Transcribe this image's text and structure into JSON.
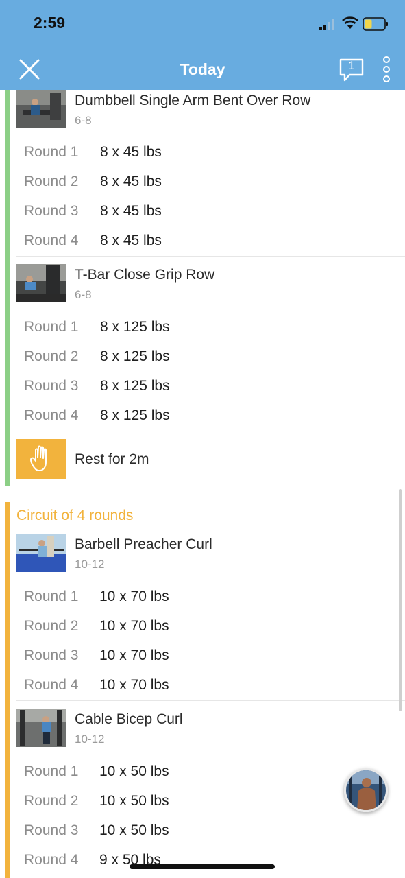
{
  "status_bar": {
    "time": "2:59"
  },
  "header": {
    "title": "Today",
    "chat_count": "1"
  },
  "colors": {
    "header": "#68ace0",
    "green_bar": "#8ccf86",
    "orange_bar": "#f2b33d",
    "circuit_title": "#f2b33d"
  },
  "set1": {
    "exercises": [
      {
        "name": "Dumbbell Single Arm Bent Over Row",
        "reps": "6-8",
        "rounds": [
          {
            "label": "Round 1",
            "value": "8 x 45 lbs"
          },
          {
            "label": "Round 2",
            "value": "8 x 45 lbs"
          },
          {
            "label": "Round 3",
            "value": "8 x 45 lbs"
          },
          {
            "label": "Round 4",
            "value": "8 x 45 lbs"
          }
        ]
      },
      {
        "name": "T-Bar Close Grip Row",
        "reps": "6-8",
        "rounds": [
          {
            "label": "Round 1",
            "value": "8 x 125 lbs"
          },
          {
            "label": "Round 2",
            "value": "8 x 125 lbs"
          },
          {
            "label": "Round 3",
            "value": "8 x 125 lbs"
          },
          {
            "label": "Round 4",
            "value": "8 x 125 lbs"
          }
        ]
      }
    ],
    "rest": {
      "label": "Rest for 2m",
      "icon": "hand-icon"
    }
  },
  "circuit": {
    "title": "Circuit of 4 rounds",
    "exercises": [
      {
        "name": "Barbell Preacher Curl",
        "reps": "10-12",
        "rounds": [
          {
            "label": "Round 1",
            "value": "10 x 70 lbs"
          },
          {
            "label": "Round 2",
            "value": "10 x 70 lbs"
          },
          {
            "label": "Round 3",
            "value": "10 x 70 lbs"
          },
          {
            "label": "Round 4",
            "value": "10 x 70 lbs"
          }
        ]
      },
      {
        "name": "Cable Bicep Curl",
        "reps": "10-12",
        "rounds": [
          {
            "label": "Round 1",
            "value": "10 x 50 lbs"
          },
          {
            "label": "Round 2",
            "value": "10 x 50 lbs"
          },
          {
            "label": "Round 3",
            "value": "10 x 50 lbs"
          },
          {
            "label": "Round 4",
            "value": "9 x 50 lbs"
          }
        ]
      }
    ]
  }
}
